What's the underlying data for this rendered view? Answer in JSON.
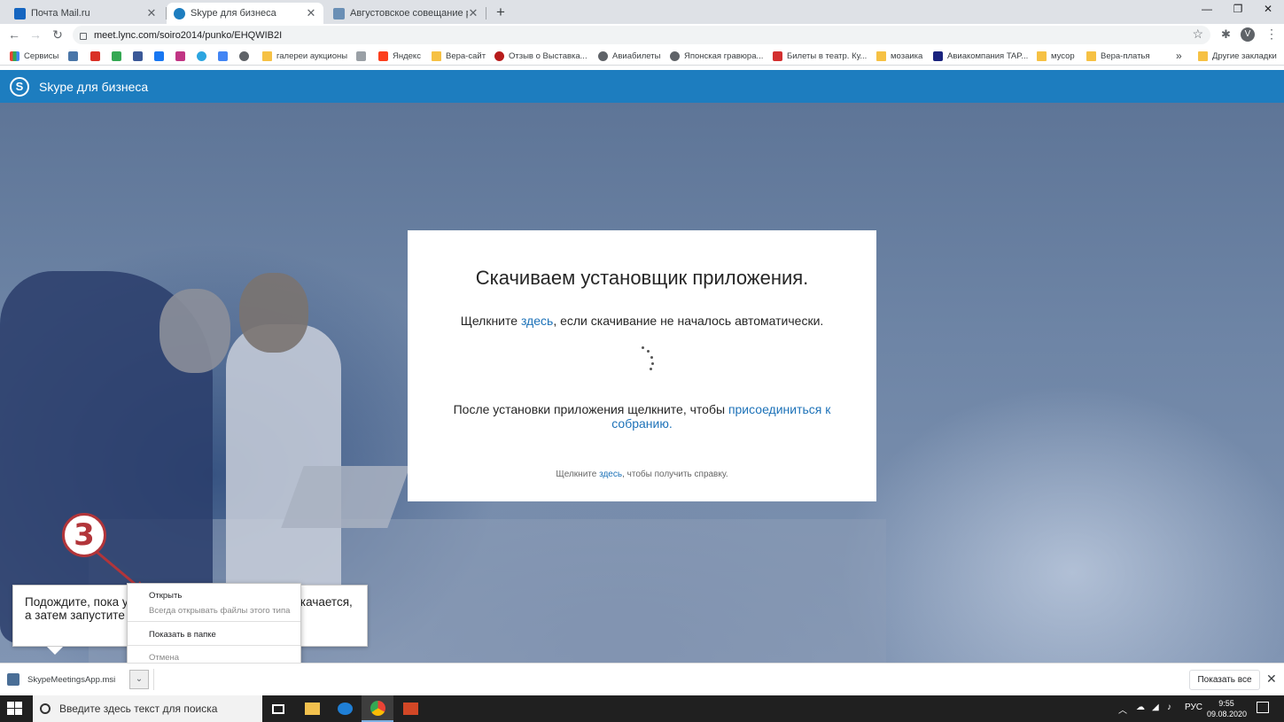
{
  "tabs": [
    {
      "title": "Почта Mail.ru",
      "favicon": "mail-ru-icon",
      "color": "#1565c0"
    },
    {
      "title": "Skype для бизнеса",
      "favicon": "skype-icon",
      "color": "#1d7dbf"
    },
    {
      "title": "Августовское совещание работ",
      "favicon": "dolphin-icon",
      "color": "#6a8fb5"
    }
  ],
  "address": {
    "url": "meet.lync.com/soiro2014/punko/EHQWIB2I"
  },
  "profile_initial": "V",
  "bookmarks": [
    {
      "label": "Сервисы",
      "icon": "apps-grid-icon",
      "color": "#ea4335"
    },
    {
      "label": "",
      "icon": "vk-icon",
      "color": "#4a76a8"
    },
    {
      "label": "",
      "icon": "gmail-icon",
      "color": "#d93025"
    },
    {
      "label": "",
      "icon": "google-drive-icon",
      "color": "#34a853"
    },
    {
      "label": "",
      "icon": "camera-icon",
      "color": "#3b5998"
    },
    {
      "label": "",
      "icon": "facebook-icon",
      "color": "#1877f2"
    },
    {
      "label": "",
      "icon": "instagram-icon",
      "color": "#c13584"
    },
    {
      "label": "",
      "icon": "telegram-icon",
      "color": "#2ca5e0"
    },
    {
      "label": "",
      "icon": "docs-icon",
      "color": "#4285f4"
    },
    {
      "label": "",
      "icon": "globe-icon",
      "color": "#5f6368"
    },
    {
      "label": "галереи аукционы",
      "icon": "folder-icon",
      "color": "#f6c144"
    },
    {
      "label": "",
      "icon": "feather-icon",
      "color": "#9aa0a6"
    },
    {
      "label": "Яндекс",
      "icon": "yandex-icon",
      "color": "#fc3f1d"
    },
    {
      "label": "Вера-сайт",
      "icon": "folder-icon",
      "color": "#f6c144"
    },
    {
      "label": "Отзыв о Выставка...",
      "icon": "circle-badge-icon",
      "color": "#b71c1c"
    },
    {
      "label": "Авиабилеты",
      "icon": "globe-icon",
      "color": "#5f6368"
    },
    {
      "label": "Японская гравюра...",
      "icon": "globe-icon",
      "color": "#5f6368"
    },
    {
      "label": "Билеты в театр. Ку...",
      "icon": "ticket-icon",
      "color": "#d32f2f"
    },
    {
      "label": "мозаика",
      "icon": "folder-icon",
      "color": "#f6c144"
    },
    {
      "label": "Авиакомпания TAP...",
      "icon": "airline-icon",
      "color": "#1a237e"
    },
    {
      "label": "мусор",
      "icon": "folder-icon",
      "color": "#f6c144"
    },
    {
      "label": "Вера-платья",
      "icon": "folder-icon",
      "color": "#f6c144"
    }
  ],
  "bookmarks_more": "»",
  "other_bookmarks": "Другие закладки",
  "app_header": {
    "title": "Skype для бизнеса",
    "logo": "S"
  },
  "dialog": {
    "title": "Скачиваем установщик приложения.",
    "line1_pre": "Щелкните ",
    "line1_link": "здесь",
    "line1_post": ", если скачивание не началось автоматически.",
    "line2_pre": "После установки приложения щелкните, чтобы ",
    "line2_link": "присоединиться к собранию.",
    "help_pre": "Щелкните ",
    "help_link": "здесь",
    "help_post": ", чтобы получить справку."
  },
  "callout": {
    "text": "Подождите, пока установщик \"Собрания Skype\" скачается, а затем запустите приложение.",
    "step_number": "3"
  },
  "context_menu": {
    "open": "Открыть",
    "always_open": "Всегда открывать файлы этого типа",
    "show_in_folder": "Показать в папке",
    "cancel": "Отмена"
  },
  "download_bar": {
    "filename": "SkypeMeetingsApp.msi",
    "show_all": "Показать все"
  },
  "taskbar": {
    "search_placeholder": "Введите здесь текст для поиска",
    "language": "РУС",
    "time": "9:55",
    "date": "09.08.2020"
  },
  "colors": {
    "accent": "#1d7dbf",
    "link": "#1d72b8",
    "step_badge": "#b2353a"
  }
}
